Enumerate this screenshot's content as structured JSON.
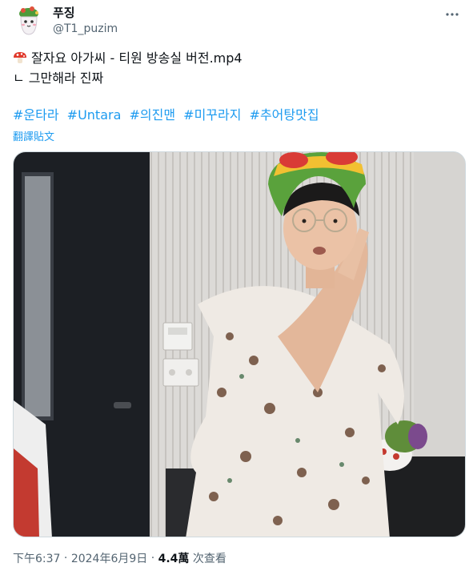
{
  "author": {
    "display_name": "푸징",
    "handle": "@T1_puzim"
  },
  "tweet": {
    "line1": "잘자요 아가씨 - 티원 방송실 버전.mp4",
    "line2": "ㄴ 그만해라 진짜",
    "hashtags": [
      "#운타라",
      "#Untara",
      "#의진맨",
      "#미꾸라지",
      "#추어탕맛집"
    ],
    "translate_label": "翻譯貼文"
  },
  "footer": {
    "time": "下午6:37",
    "date": "2024年6月9日",
    "views_count": "4.4萬",
    "views_label": "次查看",
    "separator": "·"
  },
  "icons": {
    "more": "more-horizontal-icon",
    "emoji": "mushroom-emoji"
  },
  "colors": {
    "link": "#1d9bf0",
    "secondary_text": "#536471",
    "primary_text": "#0f1419"
  }
}
